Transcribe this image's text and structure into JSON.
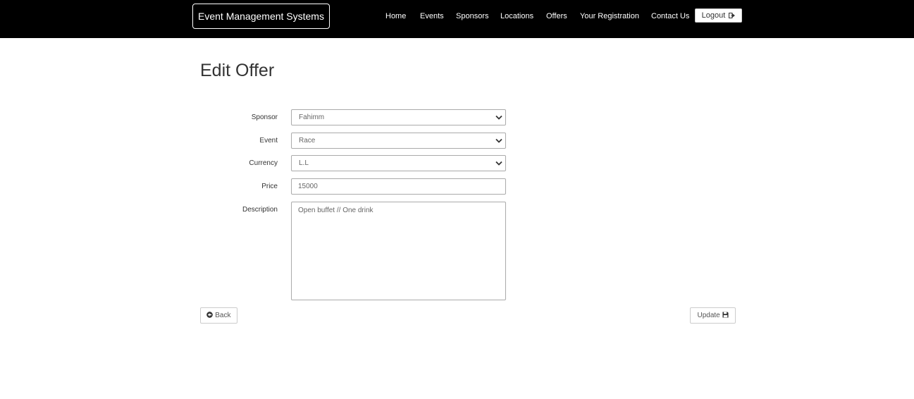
{
  "navbar": {
    "brand": "Event Management Systems",
    "links": [
      "Home",
      "Events",
      "Sponsors",
      "Locations",
      "Offers",
      "Your Registration",
      "Contact Us"
    ],
    "logout_label": "Logout",
    "logout_icon": "sign-out-icon"
  },
  "page": {
    "title": "Edit Offer"
  },
  "form": {
    "sponsor": {
      "label": "Sponsor",
      "value": "Fahimm"
    },
    "event": {
      "label": "Event",
      "value": "Race"
    },
    "currency": {
      "label": "Currency",
      "value": "L.L"
    },
    "price": {
      "label": "Price",
      "value": "15000"
    },
    "description": {
      "label": "Description",
      "value": "Open buffet // One drink"
    }
  },
  "actions": {
    "back_label": "Back",
    "back_icon": "circle-arrow-left-icon",
    "update_label": "Update",
    "update_icon": "floppy-disk-icon"
  }
}
